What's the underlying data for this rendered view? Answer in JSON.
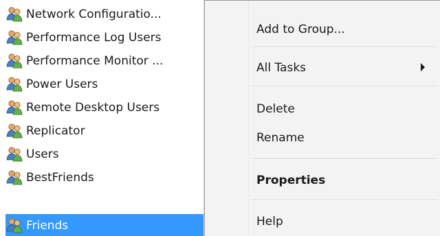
{
  "groups": [
    {
      "label": "Network Configuratio...",
      "icon": "user-group-icon"
    },
    {
      "label": "Performance Log Users",
      "icon": "user-group-icon"
    },
    {
      "label": "Performance Monitor ...",
      "icon": "user-group-icon"
    },
    {
      "label": "Power Users",
      "icon": "user-group-icon"
    },
    {
      "label": "Remote Desktop Users",
      "icon": "user-group-icon"
    },
    {
      "label": "Replicator",
      "icon": "user-group-icon"
    },
    {
      "label": "Users",
      "icon": "user-group-icon"
    },
    {
      "label": "BestFriends",
      "icon": "user-group-icon"
    },
    {
      "label": "Friends",
      "icon": "user-group-icon",
      "selected": true
    }
  ],
  "context_menu": {
    "items": [
      {
        "label": "Add to Group..."
      },
      {
        "label": "All Tasks",
        "has_submenu": true
      },
      {
        "label": "Delete"
      },
      {
        "label": "Rename"
      },
      {
        "label": "Properties",
        "bold": true
      },
      {
        "label": "Help"
      }
    ]
  },
  "colors": {
    "selection": "#3399ff",
    "menu_background": "#f3f3f3"
  }
}
